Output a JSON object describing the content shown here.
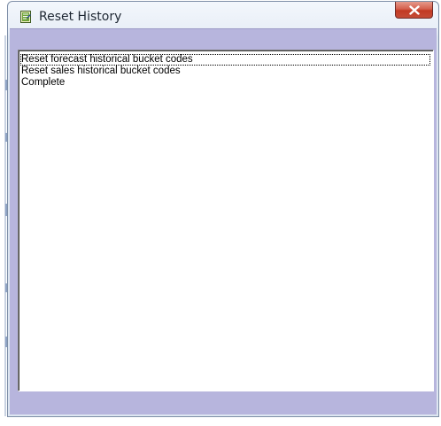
{
  "window": {
    "title": "Reset History",
    "icon": "document-icon",
    "close_icon": "close-icon"
  },
  "list": {
    "items": [
      {
        "label": "Reset forecast historical bucket codes",
        "focused": true
      },
      {
        "label": "Reset sales historical bucket codes",
        "focused": false
      },
      {
        "label": "Complete",
        "focused": false
      }
    ]
  },
  "colors": {
    "frame": "#b7b5dd",
    "close_button": "#c23a23",
    "list_background": "#ffffff"
  }
}
